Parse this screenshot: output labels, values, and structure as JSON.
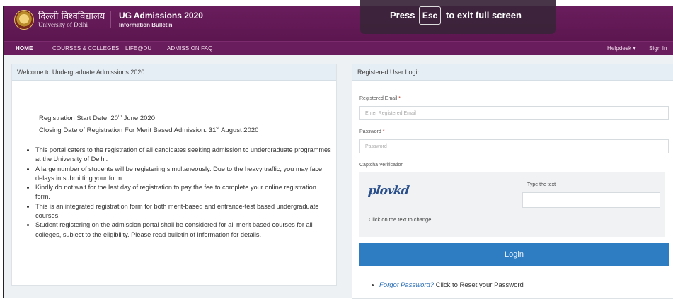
{
  "header": {
    "university_hindi": "दिल्ली विश्वविद्यालय",
    "university_english": "University of Delhi",
    "app_title": "UG Admissions 2020",
    "app_subtitle": "Information Bulletin"
  },
  "fullscreen_banner": {
    "press": "Press",
    "key": "Esc",
    "message": "to exit full screen"
  },
  "nav": {
    "items": [
      "HOME",
      "COURSES & COLLEGES",
      "LIFE@DU",
      "ADMISSION FAQ"
    ],
    "right": [
      "Helpdesk ▾",
      "Sign In"
    ]
  },
  "welcome_panel": {
    "title": "Welcome to Undergraduate Admissions 2020",
    "registration_start_prefix": "Registration Start Date: 20",
    "registration_start_sup": "th",
    "registration_start_suffix": " June 2020",
    "closing_prefix": "Closing Date of Registration For Merit Based Admission: 31",
    "closing_sup": "st",
    "closing_suffix": " August 2020",
    "bullets": [
      "This portal caters to the registration of all candidates seeking admission to undergraduate programmes at the University of Delhi.",
      "A large number of students will be registering simultaneously. Due to the heavy traffic, you may face delays in submitting your form.",
      "Kindly do not wait for the last day of registration to pay the fee to complete your online registration form.",
      "This is an integrated registration form for both merit-based and entrance-test based undergraduate courses.",
      "Student registering on the admission portal shall be considered for all merit based courses for all colleges, subject to the eligibility. Please read bulletin of information for details."
    ]
  },
  "login_panel": {
    "title": "Registered User Login",
    "email_label": "Registered Email",
    "email_placeholder": "Enter Registered Email",
    "password_label": "Password",
    "password_placeholder": "Password",
    "required_mark": "*",
    "captcha_label": "Captcha Verification",
    "captcha_text": "plovkd",
    "captcha_hint": "Click on the text to change",
    "type_text_label": "Type the text",
    "login_button": "Login",
    "forgot_link": "Forgot Password?",
    "forgot_text": " Click to Reset your Password"
  },
  "colors": {
    "header_bg": "#6a1d5d",
    "login_button": "#2e7cc2",
    "link": "#2a6db5"
  }
}
